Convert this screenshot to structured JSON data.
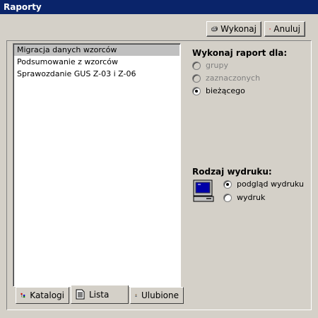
{
  "window": {
    "title": "Raporty"
  },
  "toolbar": {
    "execute_label": "Wykonaj",
    "cancel_label": "Anuluj",
    "execute_icon": "printer-icon",
    "cancel_icon": "close-icon"
  },
  "reports": {
    "items": [
      {
        "label": "Migracja danych wzorców",
        "selected": true
      },
      {
        "label": "Podsumowanie z wzorców",
        "selected": false
      },
      {
        "label": "Sprawozdanie GUS Z-03 i Z-06",
        "selected": false
      }
    ]
  },
  "tabs": [
    {
      "label": "Katalogi",
      "icon": "tree-icon",
      "active": false
    },
    {
      "label": "Lista",
      "icon": "document-icon",
      "active": true
    },
    {
      "label": "Ulubione",
      "icon": "person-icon",
      "active": false
    }
  ],
  "scope": {
    "heading": "Wykonaj raport dla:",
    "options": [
      {
        "label": "grupy",
        "enabled": false,
        "checked": false
      },
      {
        "label": "zaznaczonych",
        "enabled": false,
        "checked": false
      },
      {
        "label": "bieżącego",
        "enabled": true,
        "checked": true
      }
    ]
  },
  "print_type": {
    "heading": "Rodzaj wydruku:",
    "icon": "monitor-icon",
    "options": [
      {
        "label": "podgląd wydruku",
        "checked": true
      },
      {
        "label": "wydruk",
        "checked": false
      }
    ]
  },
  "colors": {
    "title_bar": "#0a246a",
    "face": "#d4d0c8",
    "selection": "#c0c0c0",
    "close_red": "#cc0000"
  }
}
